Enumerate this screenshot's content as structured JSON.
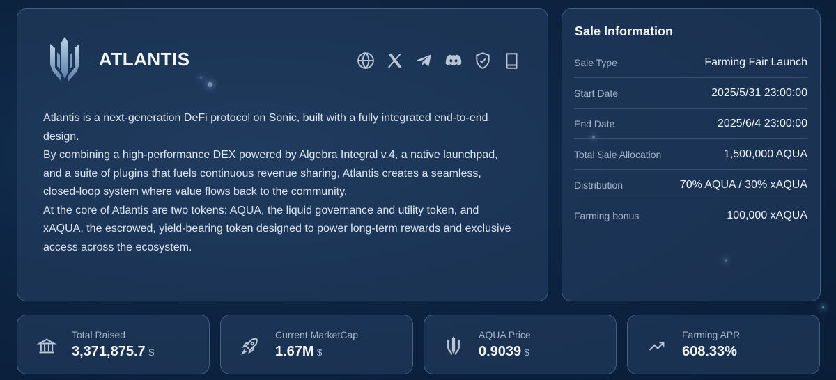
{
  "project": {
    "name": "ATLANTIS",
    "logo_icon": "atlantis-trident-logo",
    "socials": [
      {
        "icon": "globe-icon",
        "label": "Website"
      },
      {
        "icon": "x-icon",
        "label": "X"
      },
      {
        "icon": "telegram-icon",
        "label": "Telegram"
      },
      {
        "icon": "discord-icon",
        "label": "Discord"
      },
      {
        "icon": "shield-check-icon",
        "label": "Audit"
      },
      {
        "icon": "book-icon",
        "label": "Docs"
      }
    ],
    "description": [
      "Atlantis is a next-generation DeFi protocol on Sonic, built with a fully integrated end-to-end design.",
      "By combining a high-performance DEX powered by Algebra Integral v.4, a native launchpad, and a suite of plugins that fuels continuous revenue sharing, Atlantis creates a seamless, closed-loop system where value flows back to the community.",
      "At the core of Atlantis are two tokens: AQUA, the liquid governance and utility token, and xAQUA, the escrowed, yield-bearing token designed to power long-term rewards and exclusive access across the ecosystem."
    ]
  },
  "sale": {
    "title": "Sale Information",
    "rows": [
      {
        "label": "Sale Type",
        "value": "Farming Fair Launch"
      },
      {
        "label": "Start Date",
        "value": "2025/5/31 23:00:00"
      },
      {
        "label": "End Date",
        "value": "2025/6/4 23:00:00"
      },
      {
        "label": "Total Sale Allocation",
        "value": "1,500,000 AQUA"
      },
      {
        "label": "Distribution",
        "value": "70% AQUA / 30% xAQUA"
      },
      {
        "label": "Farming bonus",
        "value": "100,000 xAQUA"
      }
    ]
  },
  "stats": [
    {
      "icon": "bank-icon",
      "label": "Total Raised",
      "value": "3,371,875.7",
      "unit": "S"
    },
    {
      "icon": "rocket-icon",
      "label": "Current MarketCap",
      "value": "1.67M",
      "unit": "$"
    },
    {
      "icon": "aqua-token-icon",
      "label": "AQUA Price",
      "value": "0.9039",
      "unit": "$"
    },
    {
      "icon": "trending-up-icon",
      "label": "Farming APR",
      "value": "608.33%",
      "unit": ""
    }
  ],
  "colors": {
    "background": "#0d2442",
    "card": "#284264",
    "text_primary": "#f3f7fc",
    "text_muted": "#a3b3c7",
    "logo_accent": "#8fb0d4"
  }
}
